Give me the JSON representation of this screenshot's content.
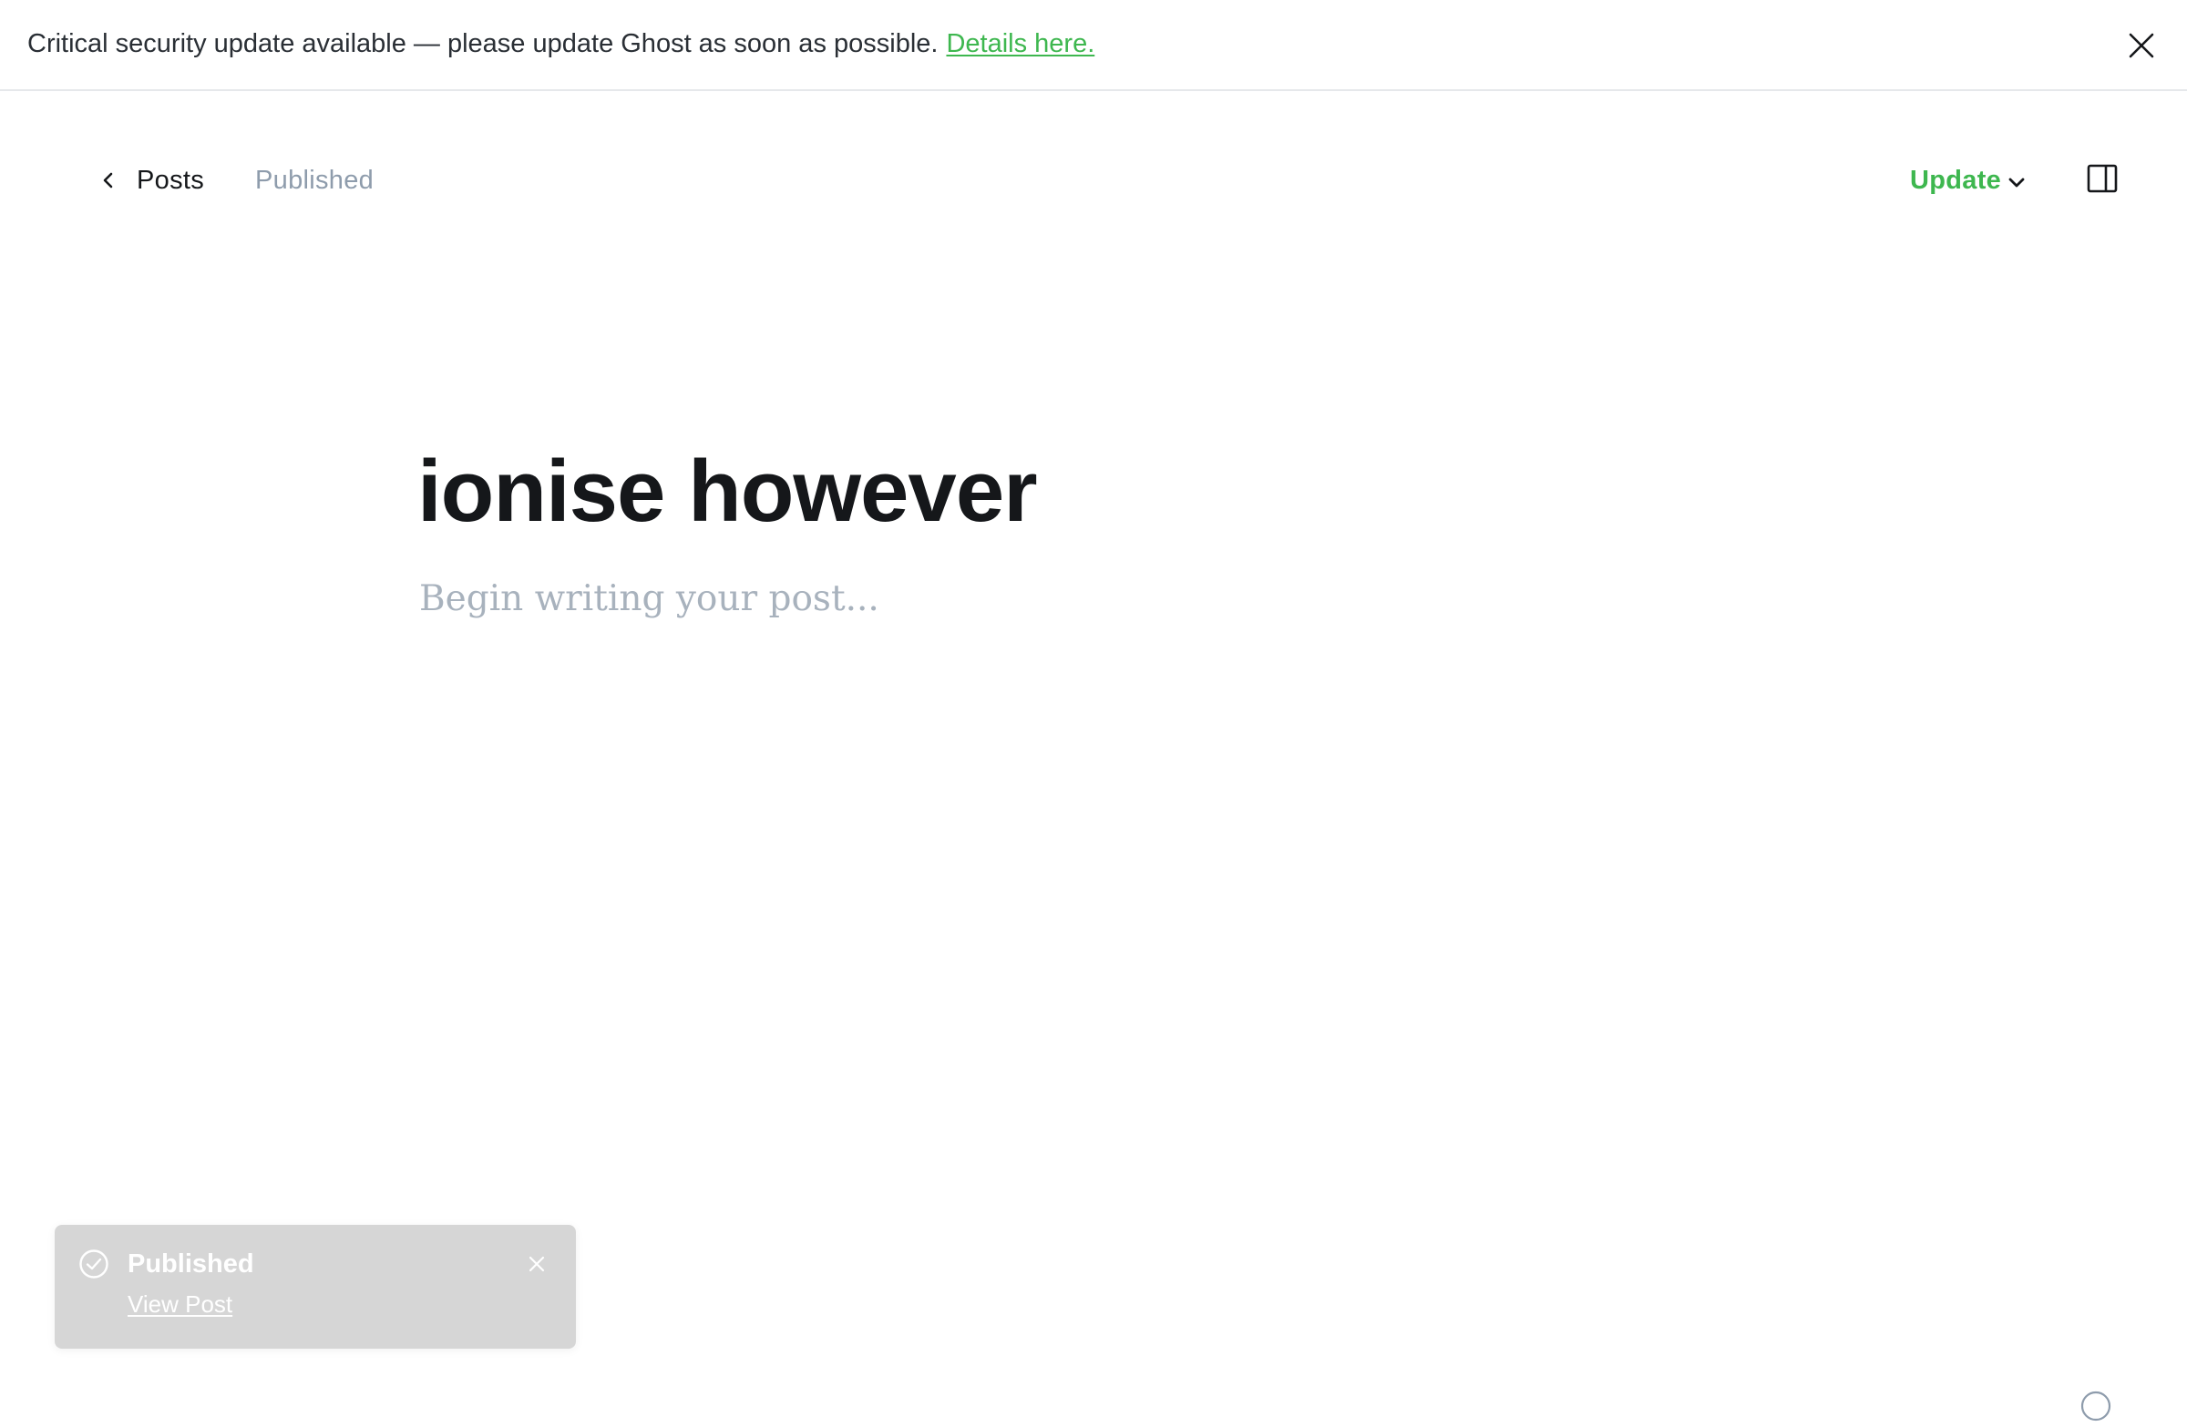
{
  "banner": {
    "message": "Critical security update available — please update Ghost as soon as possible.",
    "link_label": "Details here.",
    "close_icon": "close-icon"
  },
  "header": {
    "back_label": "Posts",
    "back_icon": "chevron-left-icon",
    "status": "Published",
    "update_label": "Update",
    "update_icon": "chevron-down-icon",
    "sidebar_icon": "sidebar-toggle-icon"
  },
  "editor": {
    "title": "ionise however",
    "body_placeholder": "Begin writing your post..."
  },
  "toast": {
    "title": "Published",
    "link_label": "View Post",
    "status_icon": "check-circle-icon",
    "close_icon": "close-icon"
  },
  "colors": {
    "accent_green": "#3eb74f",
    "muted_text": "#8e9cac",
    "placeholder_text": "#a8b2bd",
    "toast_background": "#d6d6d6"
  }
}
